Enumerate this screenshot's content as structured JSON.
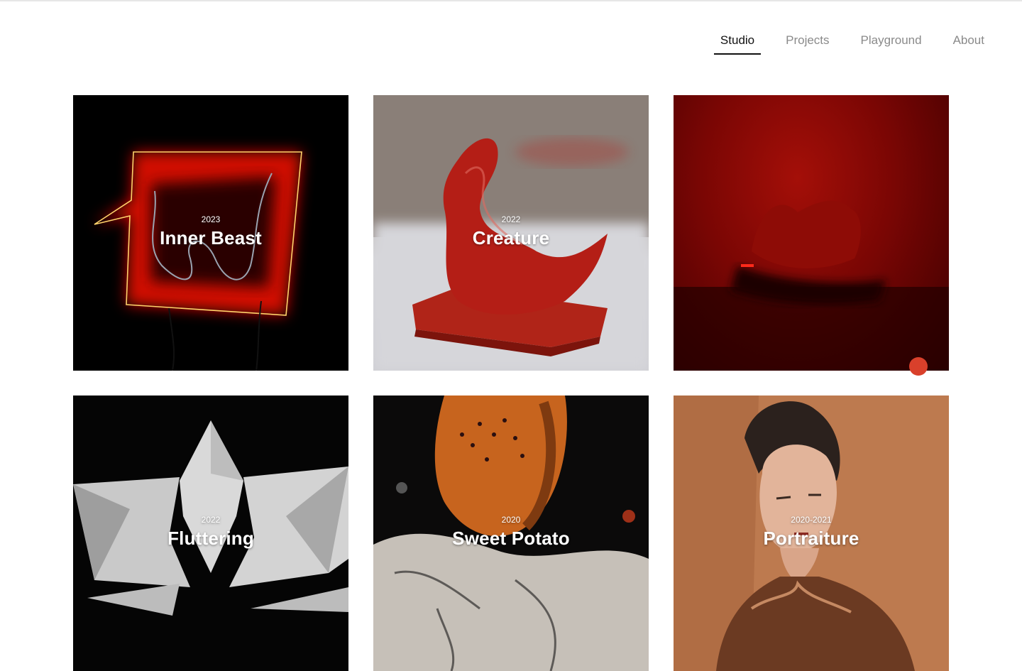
{
  "nav": {
    "items": [
      {
        "label": "Studio",
        "active": true
      },
      {
        "label": "Projects",
        "active": false
      },
      {
        "label": "Playground",
        "active": false
      },
      {
        "label": "About",
        "active": false
      }
    ]
  },
  "projects": [
    {
      "year": "2023",
      "title": "Inner Beast"
    },
    {
      "year": "2022",
      "title": "Creature"
    },
    {
      "year": "",
      "title": ""
    },
    {
      "year": "2022",
      "title": "Fluttering"
    },
    {
      "year": "2020",
      "title": "Sweet Potato"
    },
    {
      "year": "2020-2021",
      "title": "Portraiture"
    }
  ],
  "colors": {
    "accent": "#d9402b",
    "active_text": "#111111",
    "inactive_text": "#8a8a8a"
  }
}
